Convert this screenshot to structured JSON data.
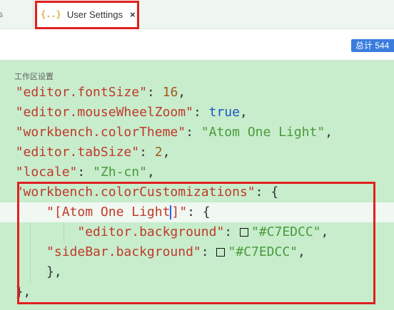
{
  "tabs": {
    "prev_label": "s",
    "active": {
      "icon_text": "{..}",
      "label": "User Settings",
      "close_glyph": "×"
    }
  },
  "summary": {
    "count_label": "总计 544"
  },
  "section": {
    "label": "工作区设置"
  },
  "editor": {
    "lines": [
      {
        "key": "\"editor.fontSize\"",
        "value": "16",
        "value_type": "number"
      },
      {
        "key": "\"editor.mouseWheelZoom\"",
        "value": "true",
        "value_type": "bool"
      },
      {
        "key": "\"workbench.colorTheme\"",
        "value": "\"Atom One Light\"",
        "value_type": "string"
      },
      {
        "key": "\"editor.tabSize\"",
        "value": "2",
        "value_type": "number"
      },
      {
        "key": "\"locale\"",
        "value": "\"Zh-cn\"",
        "value_type": "string"
      },
      {
        "key": "\"workbench.colorCustomizations\"",
        "value": "{",
        "value_type": "punct"
      },
      {
        "key_open": "\"[Atom One Light",
        "key_close": "]\"",
        "value": "{",
        "value_type": "punct"
      },
      {
        "key": "\"editor.background\"",
        "value": "\"#C7EDCC\"",
        "value_type": "string",
        "swatch": "#C7EDCC"
      },
      {
        "key": "\"sideBar.background\"",
        "value": "\"#C7EDCC\"",
        "value_type": "string",
        "swatch": "#C7EDCC"
      },
      {
        "text": "},"
      },
      {
        "text": "},"
      }
    ]
  },
  "colors": {
    "background": "#C7EDCC",
    "key": "#C0392B",
    "string": "#4A9A3A",
    "number": "#A05A1C",
    "bool": "#1A55C4",
    "highlight": "#E02020",
    "badge": "#3B7DDD"
  }
}
